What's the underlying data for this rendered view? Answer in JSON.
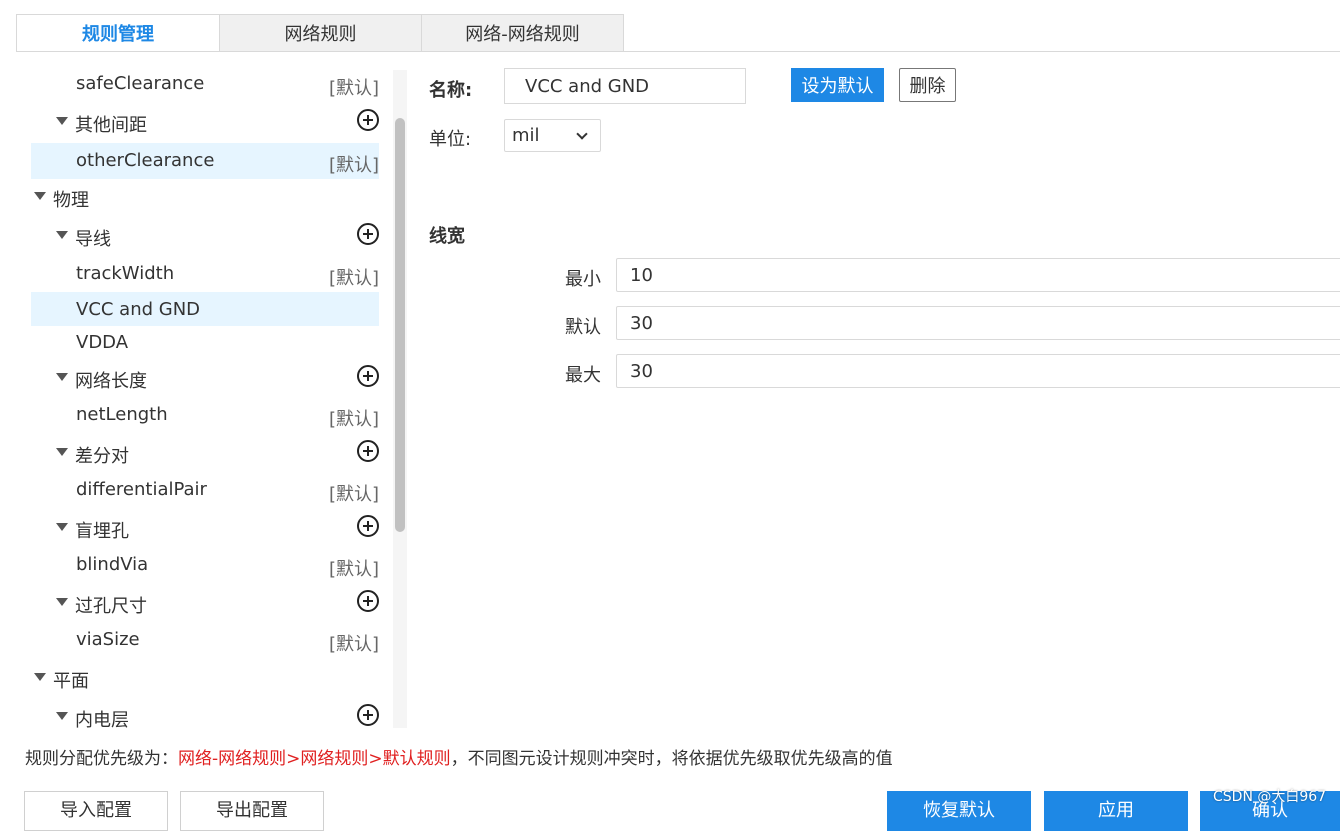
{
  "tabs": [
    "规则管理",
    "网络规则",
    "网络-网络规则"
  ],
  "tree": [
    {
      "label": "safeClearance",
      "tag": "[默认]"
    },
    {
      "label": "其他间距"
    },
    {
      "label": "otherClearance",
      "tag": "[默认]"
    },
    {
      "label": "物理"
    },
    {
      "label": "导线"
    },
    {
      "label": "trackWidth",
      "tag": "[默认]"
    },
    {
      "label": "VCC and GND"
    },
    {
      "label": "VDDA"
    },
    {
      "label": "网络长度"
    },
    {
      "label": "netLength",
      "tag": "[默认]"
    },
    {
      "label": "差分对"
    },
    {
      "label": "differentialPair",
      "tag": "[默认]"
    },
    {
      "label": "盲埋孔"
    },
    {
      "label": "blindVia",
      "tag": "[默认]"
    },
    {
      "label": "过孔尺寸"
    },
    {
      "label": "viaSize",
      "tag": "[默认]"
    },
    {
      "label": "平面"
    },
    {
      "label": "内电层"
    }
  ],
  "form": {
    "name_label": "名称:",
    "name_value": "VCC and GND",
    "set_default_label": "设为默认",
    "delete_label": "删除",
    "unit_label": "单位:",
    "unit_value": "mil",
    "section_title": "线宽",
    "min_label": "最小",
    "min_value": "10",
    "default_label": "默认",
    "default_value": "30",
    "max_label": "最大",
    "max_value": "30"
  },
  "priority": {
    "prefix": "规则分配优先级为：",
    "order": "网络-网络规则>网络规则>默认规则",
    "suffix": "，不同图元设计规则冲突时，将依据优先级取优先级高的值"
  },
  "bottom_buttons": {
    "import": "导入配置",
    "export": "导出配置",
    "restore": "恢复默认",
    "apply": "应用",
    "confirm": "确认"
  },
  "watermark": "CSDN @大白967",
  "colors": {
    "accent": "#1e88e5",
    "selected_row": "#e6f5ff",
    "warning_red": "#e02020"
  }
}
